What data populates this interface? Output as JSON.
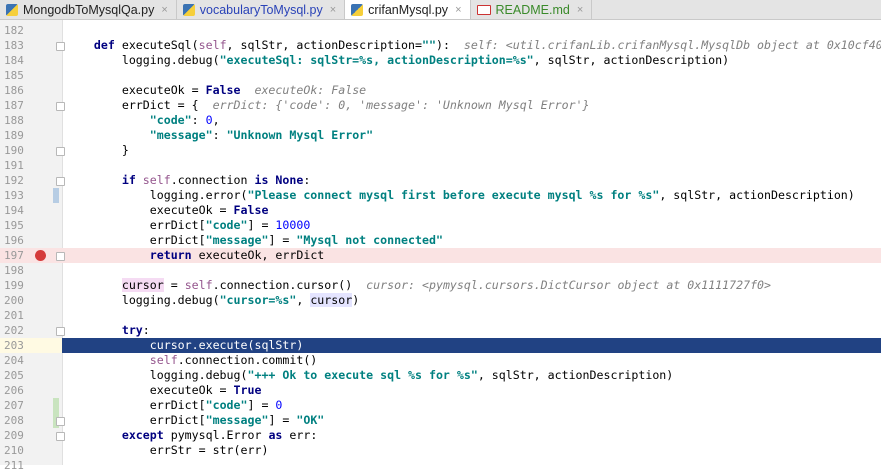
{
  "tabs": [
    {
      "label": "MongodbToMysqlQa.py",
      "kind": "py"
    },
    {
      "label": "vocabularyToMysql.py",
      "kind": "vc"
    },
    {
      "label": "crifanMysql.py",
      "kind": "py",
      "active": true
    },
    {
      "label": "README.md",
      "kind": "md"
    }
  ],
  "close_glyph": "×",
  "colors": {
    "selection": "#214283",
    "error_line": "#fae3e3",
    "breakpoint": "#d53a3a"
  },
  "lines": [
    {
      "n": "182",
      "t": []
    },
    {
      "n": "183",
      "fold": true,
      "t": [
        [
          "    ",
          "pl"
        ],
        [
          "def ",
          "kw"
        ],
        [
          "executeSql(",
          "pl"
        ],
        [
          "self",
          "self"
        ],
        [
          ", sqlStr, actionDescription=",
          "pl"
        ],
        [
          "\"\"",
          "str"
        ],
        [
          "):  ",
          "pl"
        ],
        [
          "self: <util.crifanLib.crifanMysql.MysqlDb object at 0x10cf40",
          "hint"
        ]
      ]
    },
    {
      "n": "184",
      "t": [
        [
          "        logging.debug(",
          "pl"
        ],
        [
          "\"executeSql: sqlStr=%s, actionDescription=%s\"",
          "str"
        ],
        [
          ", sqlStr, actionDescription)",
          "pl"
        ]
      ]
    },
    {
      "n": "185",
      "t": []
    },
    {
      "n": "186",
      "t": [
        [
          "        executeOk = ",
          "pl"
        ],
        [
          "False",
          "kw"
        ],
        [
          "  executeOk: False",
          "hint"
        ]
      ]
    },
    {
      "n": "187",
      "fold": true,
      "t": [
        [
          "        errDict = {  ",
          "pl"
        ],
        [
          "errDict: {'code': 0, 'message': 'Unknown Mysql Error'}",
          "hint"
        ]
      ]
    },
    {
      "n": "188",
      "t": [
        [
          "            ",
          "pl"
        ],
        [
          "\"code\"",
          "str"
        ],
        [
          ": ",
          "pl"
        ],
        [
          "0",
          "num"
        ],
        [
          ",",
          "pl"
        ]
      ]
    },
    {
      "n": "189",
      "t": [
        [
          "            ",
          "pl"
        ],
        [
          "\"message\"",
          "str"
        ],
        [
          ": ",
          "pl"
        ],
        [
          "\"Unknown Mysql Error\"",
          "str"
        ]
      ]
    },
    {
      "n": "190",
      "fold": true,
      "t": [
        [
          "        }",
          "pl"
        ]
      ]
    },
    {
      "n": "191",
      "t": []
    },
    {
      "n": "192",
      "fold": true,
      "t": [
        [
          "        ",
          "pl"
        ],
        [
          "if ",
          "kw"
        ],
        [
          "self",
          "self"
        ],
        [
          ".connection ",
          "pl"
        ],
        [
          "is None",
          "kw"
        ],
        [
          ":",
          "pl"
        ]
      ]
    },
    {
      "n": "193",
      "chg": "#b7cde4",
      "t": [
        [
          "            logging.error(",
          "pl"
        ],
        [
          "\"Please connect mysql first before execute mysql %s for %s\"",
          "str"
        ],
        [
          ", sqlStr, actionDescription)",
          "pl"
        ]
      ]
    },
    {
      "n": "194",
      "t": [
        [
          "            executeOk = ",
          "pl"
        ],
        [
          "False",
          "kw"
        ]
      ]
    },
    {
      "n": "195",
      "t": [
        [
          "            errDict[",
          "pl"
        ],
        [
          "\"code\"",
          "str"
        ],
        [
          "] = ",
          "pl"
        ],
        [
          "10000",
          "num"
        ]
      ]
    },
    {
      "n": "196",
      "t": [
        [
          "            errDict[",
          "pl"
        ],
        [
          "\"message\"",
          "str"
        ],
        [
          "] = ",
          "pl"
        ],
        [
          "\"Mysql not connected\"",
          "str"
        ]
      ]
    },
    {
      "n": "197",
      "bp": true,
      "err": true,
      "fold": true,
      "t": [
        [
          "            ",
          "pl"
        ],
        [
          "return ",
          "kw"
        ],
        [
          "executeOk, errDict",
          "pl"
        ]
      ]
    },
    {
      "n": "198",
      "t": []
    },
    {
      "n": "199",
      "t": [
        [
          "        ",
          "pl"
        ],
        [
          "cursor",
          "hl1"
        ],
        [
          " = ",
          "pl"
        ],
        [
          "self",
          "self"
        ],
        [
          ".connection.cursor()  ",
          "pl"
        ],
        [
          "cursor: <pymysql.cursors.DictCursor object at 0x1111727f0>",
          "hint"
        ]
      ]
    },
    {
      "n": "200",
      "t": [
        [
          "        logging.debug(",
          "pl"
        ],
        [
          "\"cursor=%s\"",
          "str"
        ],
        [
          ", ",
          "pl"
        ],
        [
          "cursor",
          "hl2"
        ],
        [
          ")",
          "pl"
        ]
      ]
    },
    {
      "n": "201",
      "t": []
    },
    {
      "n": "202",
      "fold": true,
      "t": [
        [
          "        ",
          "pl"
        ],
        [
          "try",
          "kw"
        ],
        [
          ":",
          "pl"
        ]
      ]
    },
    {
      "n": "203",
      "sel": true,
      "t": [
        [
          "            cursor.execute(sqlStr)",
          "pl"
        ]
      ]
    },
    {
      "n": "204",
      "t": [
        [
          "            ",
          "pl"
        ],
        [
          "self",
          "self"
        ],
        [
          ".connection.commit()",
          "pl"
        ]
      ]
    },
    {
      "n": "205",
      "t": [
        [
          "            logging.debug(",
          "pl"
        ],
        [
          "\"+++ Ok to execute sql %s for %s\"",
          "str"
        ],
        [
          ", sqlStr, actionDescription)",
          "pl"
        ]
      ]
    },
    {
      "n": "206",
      "t": [
        [
          "            executeOk = ",
          "pl"
        ],
        [
          "True",
          "kw"
        ]
      ]
    },
    {
      "n": "207",
      "chg": "#c9e4bf",
      "t": [
        [
          "            errDict[",
          "pl"
        ],
        [
          "\"code\"",
          "str"
        ],
        [
          "] = ",
          "pl"
        ],
        [
          "0",
          "num"
        ]
      ]
    },
    {
      "n": "208",
      "chg": "#c9e4bf",
      "fold": true,
      "t": [
        [
          "            errDict[",
          "pl"
        ],
        [
          "\"message\"",
          "str"
        ],
        [
          "] = ",
          "pl"
        ],
        [
          "\"OK\"",
          "str"
        ]
      ]
    },
    {
      "n": "209",
      "fold": true,
      "t": [
        [
          "        ",
          "pl"
        ],
        [
          "except ",
          "kw"
        ],
        [
          "pymysql.Error ",
          "pl"
        ],
        [
          "as ",
          "kw"
        ],
        [
          "err:",
          "pl"
        ]
      ]
    },
    {
      "n": "210",
      "t": [
        [
          "            errStr = str(err)",
          "pl"
        ]
      ]
    },
    {
      "n": "211",
      "t": []
    }
  ]
}
